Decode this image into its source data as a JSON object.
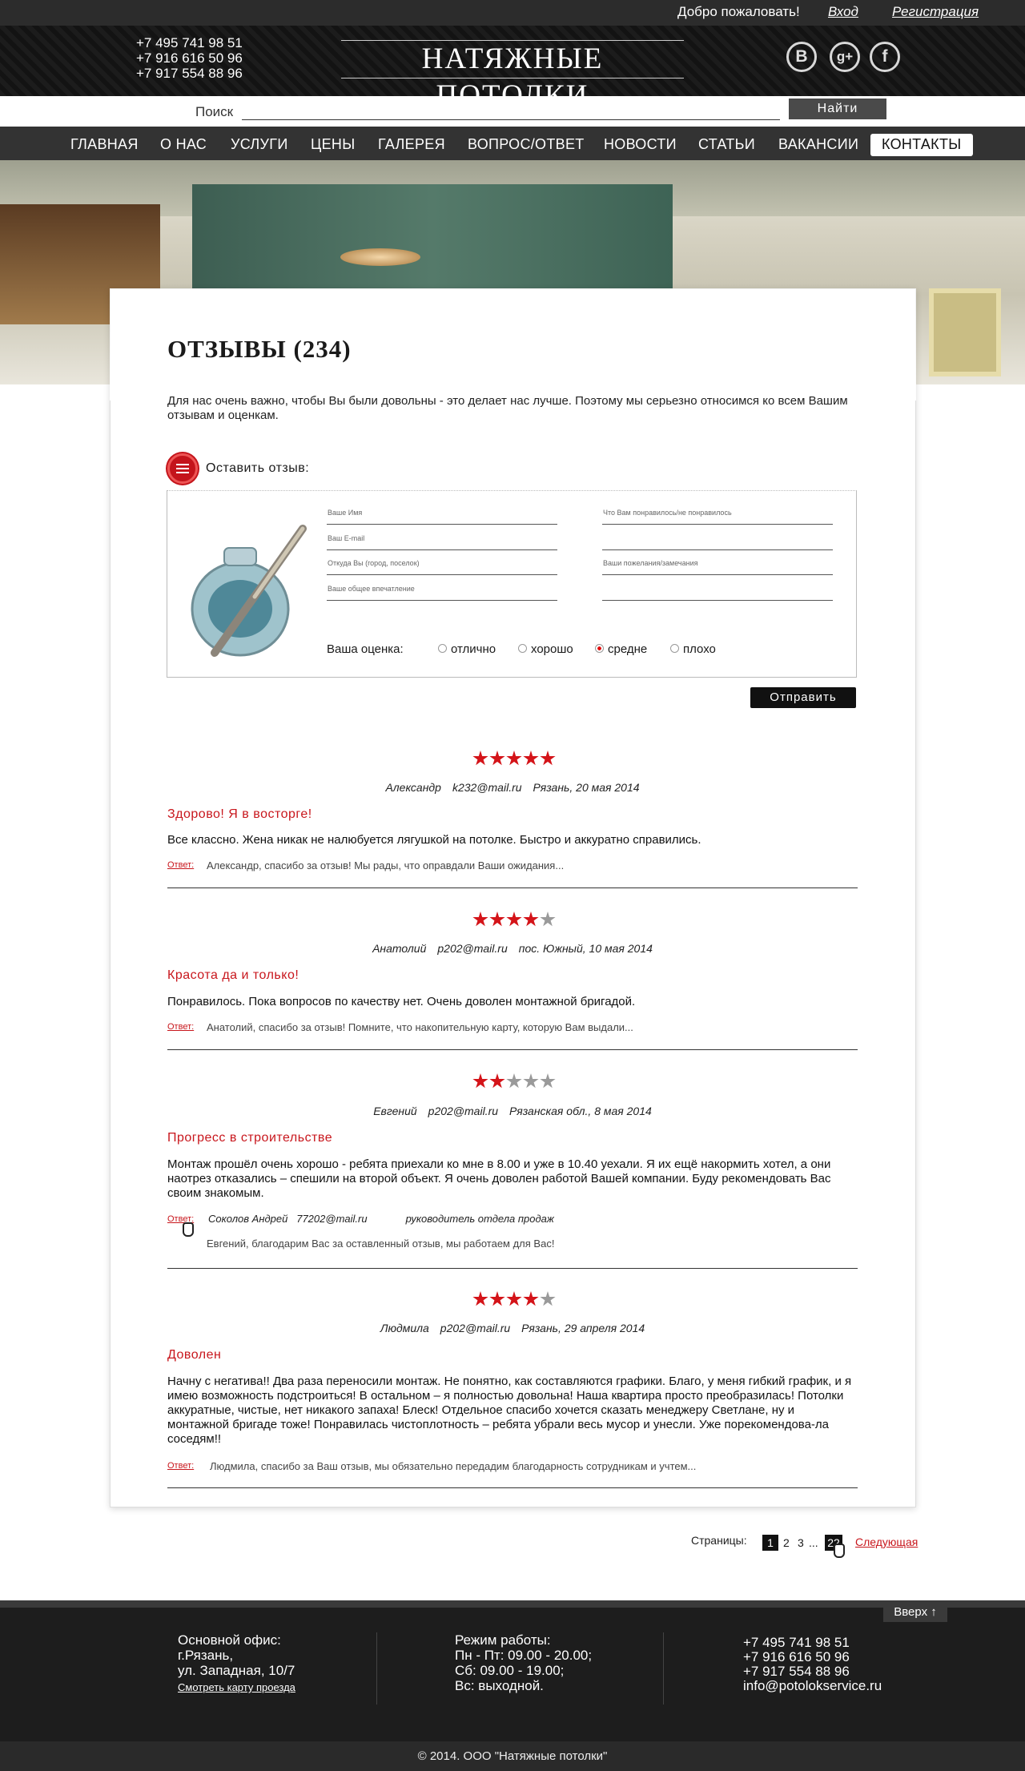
{
  "topbar": {
    "welcome": "Добро пожаловать!",
    "login": "Вход",
    "register": "Регистрация"
  },
  "header": {
    "phones": [
      "+7 495 741 98 51",
      "+7 916 616 50 96",
      "+7 917 554 88 96"
    ],
    "logo": "НАТЯЖНЫЕ ПОТОЛКИ",
    "social": [
      "В",
      "g+",
      "f"
    ]
  },
  "search": {
    "label": "Поиск",
    "button": "Найти",
    "value": ""
  },
  "nav": [
    "ГЛАВНАЯ",
    "О НАС",
    "УСЛУГИ",
    "ЦЕНЫ",
    "ГАЛЕРЕЯ",
    "ВОПРОС/ОТВЕТ",
    "НОВОСТИ",
    "СТАТЬИ",
    "ВАКАНСИИ",
    "КОНТАКТЫ"
  ],
  "page": {
    "title": "ОТЗЫВЫ (234)",
    "intro": "Для нас очень важно, чтобы Вы были довольны - это делает нас лучше. Поэтому мы серьезно относимся ко всем Вашим отзывам и оценкам.",
    "leave": "Оставить отзыв:"
  },
  "form": {
    "fields": [
      "Ваше Имя",
      "Ваш E-mail",
      "Откуда Вы (город, поселок)",
      "Ваше общее впечатление",
      "Что Вам понравилось/не понравилось",
      "",
      "Ваши пожелания/замечания",
      ""
    ],
    "rating_label": "Ваша оценка:",
    "ratings": [
      "отлично",
      "хорошо",
      "средне",
      "плохо"
    ],
    "selected": "средне",
    "submit": "Отправить"
  },
  "reviews": [
    {
      "stars": 5,
      "name": "Александр",
      "email": "k232@mail.ru",
      "place": "Рязань, 20 мая 2014",
      "title": "Здорово! Я в восторге!",
      "text": "Все классно. Жена никак не налюбуется лягушкой на потолке. Быстро и аккуратно справились.",
      "answer_label": "Ответ:",
      "answer": "Александр, спасибо за отзыв! Мы рады, что оправдали Ваши ожидания..."
    },
    {
      "stars": 4,
      "name": "Анатолий",
      "email": "p202@mail.ru",
      "place": "пос. Южный, 10 мая 2014",
      "title": "Красота да и только!",
      "text": "Понравилось. Пока вопросов по качеству нет. Очень доволен монтажной бригадой.",
      "answer_label": "Ответ:",
      "answer": "Анатолий, спасибо за отзыв! Помните, что накопительную карту, которую Вам выдали..."
    },
    {
      "stars": 2,
      "name": "Евгений",
      "email": "p202@mail.ru",
      "place": "Рязанская обл., 8 мая 2014",
      "title": "Прогресс в строительстве",
      "text": "Монтаж прошёл очень хорошо - ребята приехали ко мне в 8.00 и уже в 10.40 уехали. Я их ещё накормить хотел, а они наотрез отказались – спешили на второй объект. Я очень доволен работой Вашей компании. Буду рекомендовать Вас своим знакомым.",
      "answer_label": "Ответ:",
      "answerer": "Соколов Андрей",
      "answerer_email": "77202@mail.ru",
      "answerer_role": "руководитель отдела продаж",
      "answer": "Евгений, благодарим Вас за оставленный отзыв, мы работаем для Вас!"
    },
    {
      "stars": 4,
      "name": "Людмила",
      "email": "p202@mail.ru",
      "place": "Рязань, 29 апреля 2014",
      "title": "Доволен",
      "text": "Начну с негатива!! Два раза переносили монтаж. Не понятно, как составляются графики. Благо, у меня гибкий график, и я имею возможность подстроиться! В остальном – я полностью довольна! Наша квартира просто преобразилась! Потолки аккуратные, чистые, нет никакого запаха! Блеск! Отдельное спасибо хочется сказать менеджеру Светлане, ну и монтажной бригаде тоже! Понравилась чистоплотность – ребята убрали весь мусор и унесли. Уже порекомендова-ла соседям!!",
      "answer_label": "Ответ:",
      "answer": "Людмила, спасибо за Ваш отзыв, мы обязательно передадим благодарность сотрудникам и учтем..."
    }
  ],
  "pagination": {
    "label": "Страницы:",
    "pages": [
      "1",
      "2",
      "3",
      "...",
      "22"
    ],
    "current": "1",
    "next": "Следующая"
  },
  "footer": {
    "office": [
      "Основной офис:",
      "г.Рязань,",
      "ул. Западная, 10/7"
    ],
    "map_link": "Смотреть карту проезда",
    "hours": [
      "Режим работы:",
      "Пн - Пт: 09.00 - 20.00;",
      "Сб: 09.00 - 19.00;",
      "Вс: выходной."
    ],
    "contacts": [
      "+7 495 741 98 51",
      "+7 916 616 50 96",
      "+7 917 554 88 96",
      "info@potolokservice.ru"
    ],
    "up": "Вверх ↑",
    "copyright": "© 2014. ООО \"Натяжные потолки\""
  },
  "colors": {
    "accent": "#c8161c",
    "dark": "#1d1d1d",
    "star_on": "#d41419",
    "star_off": "#9a9a9a"
  }
}
